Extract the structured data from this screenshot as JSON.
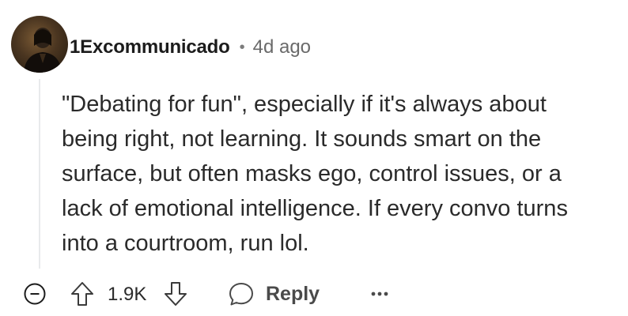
{
  "comment": {
    "username": "1Excommunicado",
    "separator": "•",
    "timestamp": "4d ago",
    "body_lines": [
      "\"Debating for fun\", especially if it's always about",
      "being right, not learning. It sounds smart on the",
      "surface, but often masks ego, control issues, or a",
      "lack of emotional intelligence. If every convo turns",
      "into a courtroom, run lol."
    ]
  },
  "actions": {
    "score": "1.9K",
    "reply_label": "Reply"
  },
  "icons": {
    "collapse": "collapse-minus-icon",
    "upvote": "upvote-arrow-icon",
    "downvote": "downvote-arrow-icon",
    "reply": "speech-bubble-icon",
    "more": "more-options-icon"
  },
  "colors": {
    "text": "#1c1c1c",
    "muted": "#6a6a6a",
    "thread_line": "#e8eaec"
  }
}
